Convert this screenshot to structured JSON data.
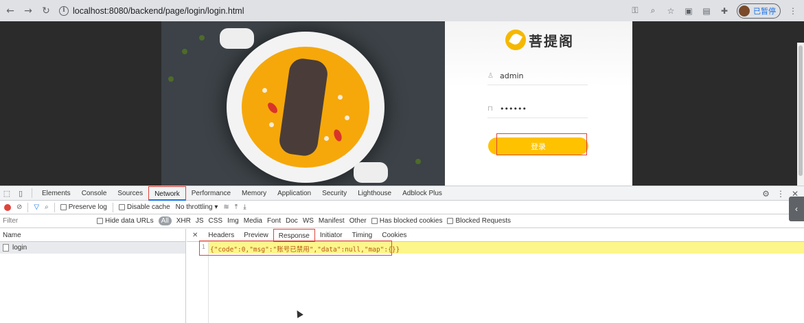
{
  "browser": {
    "url": "localhost:8080/backend/page/login/login.html",
    "profile_label": "已暂停"
  },
  "login": {
    "brand": "菩提阁",
    "username": "admin",
    "password_masked": "••••••",
    "submit_label": "登录"
  },
  "devtools": {
    "tabs": [
      "Elements",
      "Console",
      "Sources",
      "Network",
      "Performance",
      "Memory",
      "Application",
      "Security",
      "Lighthouse",
      "Adblock Plus"
    ],
    "active_tab": "Network",
    "toolbar": {
      "preserve_log": "Preserve log",
      "disable_cache": "Disable cache",
      "throttling": "No throttling"
    },
    "filter": {
      "placeholder": "Filter",
      "hide_data_urls": "Hide data URLs",
      "types": [
        "All",
        "XHR",
        "JS",
        "CSS",
        "Img",
        "Media",
        "Font",
        "Doc",
        "WS",
        "Manifest",
        "Other"
      ],
      "blocked_cookies": "Has blocked cookies",
      "blocked_requests": "Blocked Requests"
    },
    "name_header": "Name",
    "requests": [
      "login"
    ],
    "detail_tabs": [
      "Headers",
      "Preview",
      "Response",
      "Initiator",
      "Timing",
      "Cookies"
    ],
    "active_detail_tab": "Response",
    "response": {
      "line_number": "1",
      "body": "{\"code\":0,\"msg\":\"账号已禁用\",\"data\":null,\"map\":{}}"
    }
  }
}
